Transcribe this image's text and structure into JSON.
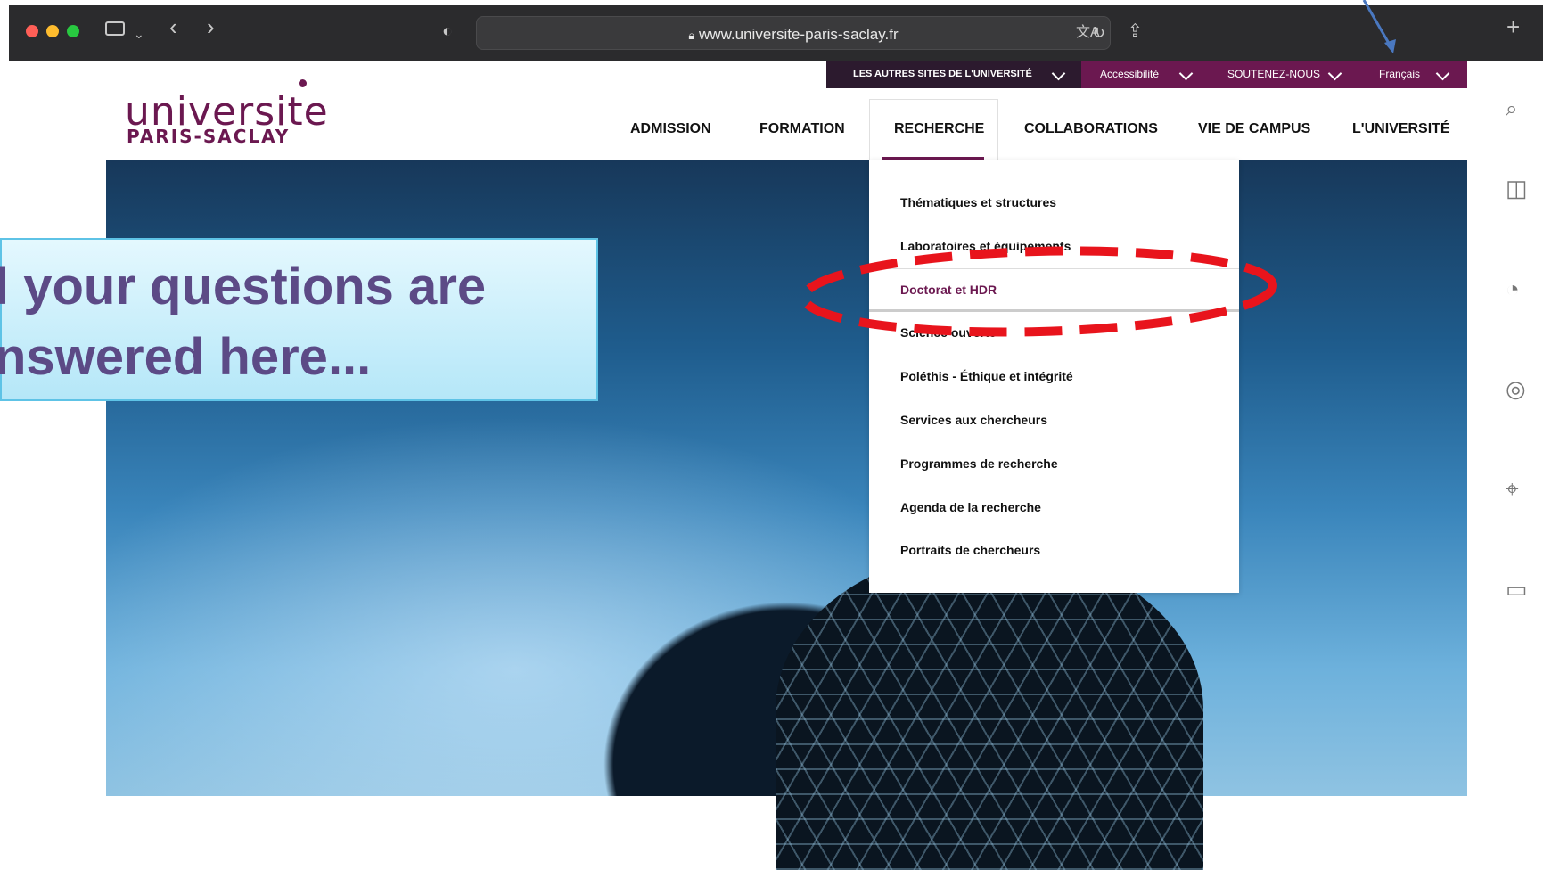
{
  "browser": {
    "url": "www.universite-paris-saclay.fr",
    "icons": [
      "sidebar-icon",
      "chevron-down-icon",
      "back-icon",
      "forward-icon",
      "shield-icon",
      "lock-icon",
      "translate-icon",
      "reload-icon",
      "share-icon",
      "new-tab-icon"
    ],
    "traffic_light_colors": [
      "#ff5f57",
      "#febc2e",
      "#28c840"
    ]
  },
  "utility_bar": {
    "other_sites": "LES AUTRES SITES DE L'UNIVERSITÉ",
    "accessibility": "Accessibilité",
    "support": "SOUTENEZ-NOUS",
    "language": "Français"
  },
  "logo": {
    "line1": "universite",
    "line2": "PARIS-SACLAY"
  },
  "nav": {
    "items": [
      "ADMISSION",
      "FORMATION",
      "RECHERCHE",
      "COLLABORATIONS",
      "VIE DE CAMPUS",
      "L'UNIVERSITÉ"
    ],
    "active": "RECHERCHE"
  },
  "dropdown": {
    "items": [
      "Thématiques et structures",
      "Laboratoires et équipements",
      "Doctorat et HDR",
      "Science ouverte",
      "Poléthis - Éthique et intégrité",
      "Services aux chercheurs",
      "Programmes de recherche",
      "Agenda de la recherche",
      "Portraits de chercheurs"
    ],
    "highlighted": "Doctorat et HDR"
  },
  "sidebar_icons": [
    "search-icon",
    "book-icon",
    "chat-icon",
    "globe-icon",
    "map-pin-icon",
    "laptop-icon"
  ],
  "callout": {
    "line1": "l your questions are",
    "line2": "nswered here..."
  },
  "colors": {
    "brand": "#6b1850",
    "util_dark": "#2c1a2e",
    "callout_text": "#5c4a86",
    "annotation_red": "#e8141c",
    "annotation_arrow": "#4a78c0"
  }
}
